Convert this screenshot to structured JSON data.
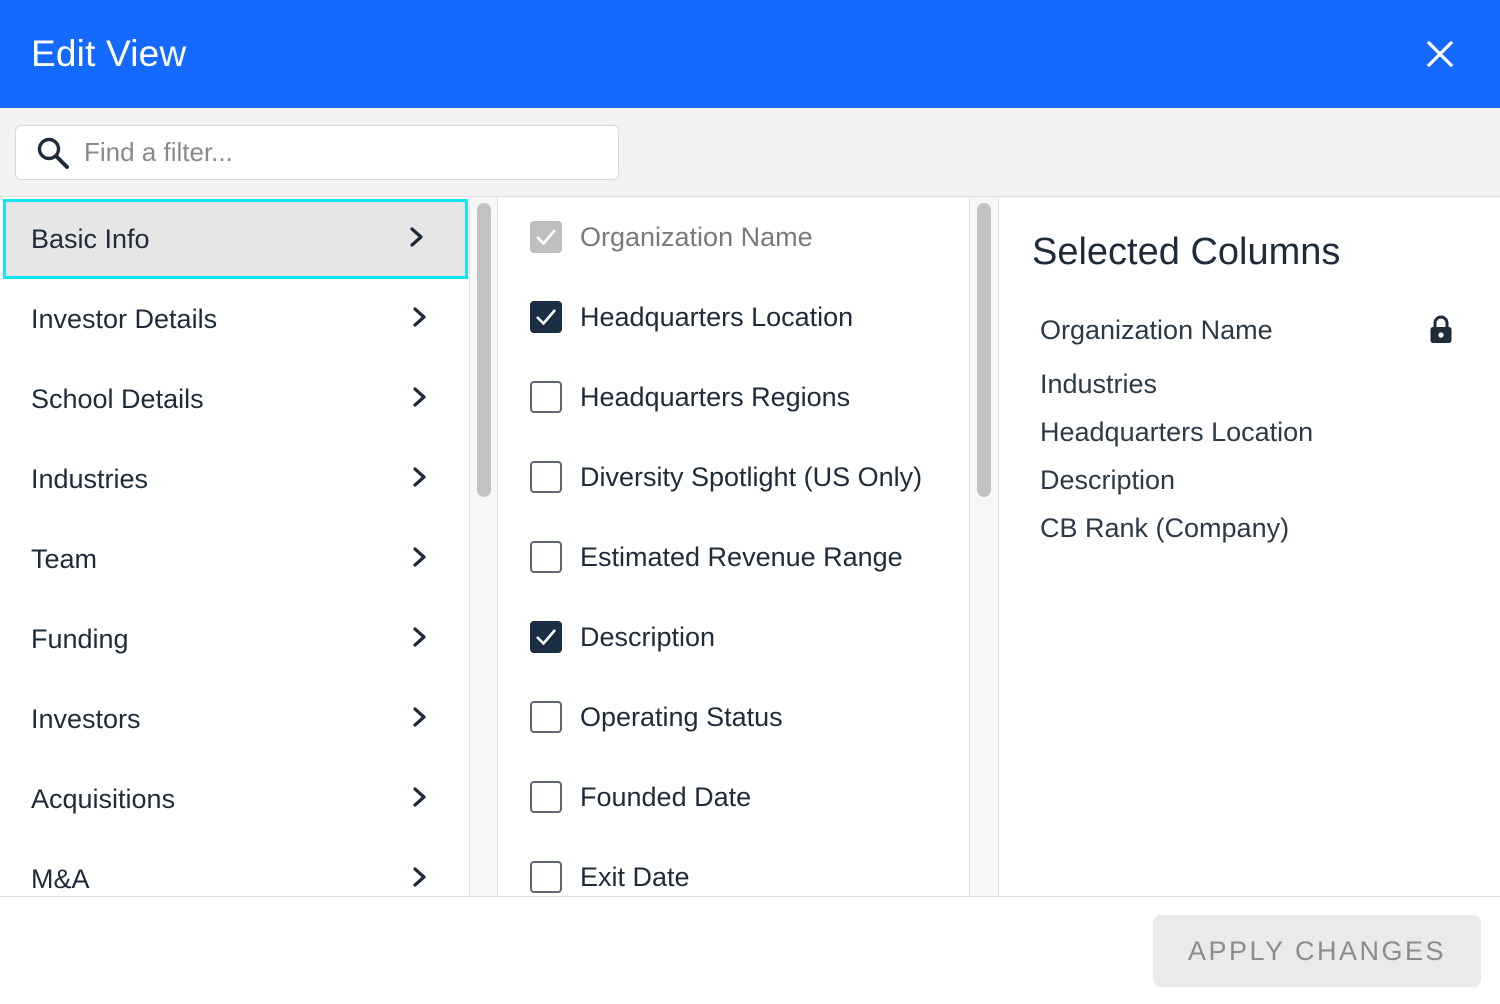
{
  "header": {
    "title": "Edit View",
    "close_icon": "close-icon",
    "background": "#146aff"
  },
  "search": {
    "placeholder": "Find a filter...",
    "value": "",
    "icon": "search-icon"
  },
  "categories": [
    {
      "label": "Basic Info",
      "active": true
    },
    {
      "label": "Investor Details",
      "active": false
    },
    {
      "label": "School Details",
      "active": false
    },
    {
      "label": "Industries",
      "active": false
    },
    {
      "label": "Team",
      "active": false
    },
    {
      "label": "Funding",
      "active": false
    },
    {
      "label": "Investors",
      "active": false
    },
    {
      "label": "Acquisitions",
      "active": false
    },
    {
      "label": "M&A",
      "active": false
    }
  ],
  "fields": [
    {
      "label": "Organization Name",
      "checked": true,
      "disabled": true
    },
    {
      "label": "Headquarters Location",
      "checked": true,
      "disabled": false
    },
    {
      "label": "Headquarters Regions",
      "checked": false,
      "disabled": false
    },
    {
      "label": "Diversity Spotlight (US Only)",
      "checked": false,
      "disabled": false
    },
    {
      "label": "Estimated Revenue Range",
      "checked": false,
      "disabled": false
    },
    {
      "label": "Description",
      "checked": true,
      "disabled": false
    },
    {
      "label": "Operating Status",
      "checked": false,
      "disabled": false
    },
    {
      "label": "Founded Date",
      "checked": false,
      "disabled": false
    },
    {
      "label": "Exit Date",
      "checked": false,
      "disabled": false
    }
  ],
  "selected": {
    "title": "Selected Columns",
    "items": [
      {
        "label": "Organization Name",
        "locked": true
      },
      {
        "label": "Industries",
        "locked": false
      },
      {
        "label": "Headquarters Location",
        "locked": false
      },
      {
        "label": "Description",
        "locked": false
      },
      {
        "label": "CB Rank (Company)",
        "locked": false
      }
    ]
  },
  "footer": {
    "apply_label": "APPLY CHANGES"
  },
  "colors": {
    "accent": "#146aff",
    "focus": "#11e6f2",
    "checkbox_checked": "#1b2f44"
  }
}
